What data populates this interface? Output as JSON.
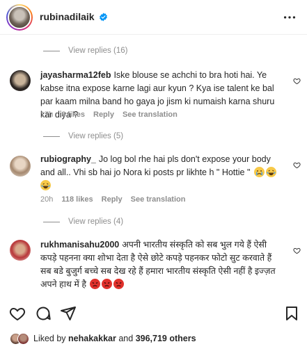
{
  "header": {
    "username": "rubinadilaik",
    "verified_color": "#0095f6"
  },
  "threads": [
    {
      "view_replies": "View replies (16)"
    },
    {
      "view_replies": "View replies (5)"
    },
    {
      "view_replies": "View replies (4)"
    }
  ],
  "comments": [
    {
      "username": "jayasharma12feb",
      "text": "Iske blouse se achchi to bra hoti hai. Ye kabse itna expose karne lagi aur kyun ? Kya ise talent ke bal par kaam milna band ho gaya jo jism ki numaish karna shuru kar diya ?",
      "time": "17h",
      "likes": "8 likes",
      "reply": "Reply",
      "translation": "See translation"
    },
    {
      "username": "rubiography_",
      "text": "Jo log bol rhe hai pls don't expose your body and all.. Vhi sb hai jo Nora ki posts pr likhte h \" Hottie \"",
      "emojis": [
        "crying-face",
        "laughing-face",
        "laughing-face"
      ],
      "time": "20h",
      "likes": "118 likes",
      "reply": "Reply",
      "translation": "See translation"
    },
    {
      "username": "rukhmanisahu2000",
      "text": "अपनी भारतीय संस्कृति को सब भुल गये हैं ऐसी कपड़े पहनना क्या शोभा देता है ऐसे छोटे कपड़े पहनकर फोटो सुट करवाते हैं सब बडे बुजुर्ग बच्चे सब देख रहे हैं हमारा भारतीय संस्कृति ऐसी नहीं है इज्ज़त अपने हाथ में है",
      "emojis": [
        "angry-face",
        "angry-face",
        "angry-face"
      ]
    }
  ],
  "likes_bar": {
    "prefix": "Liked by",
    "user": "nehakakkar",
    "middle": "and",
    "count": "396,719 others"
  }
}
